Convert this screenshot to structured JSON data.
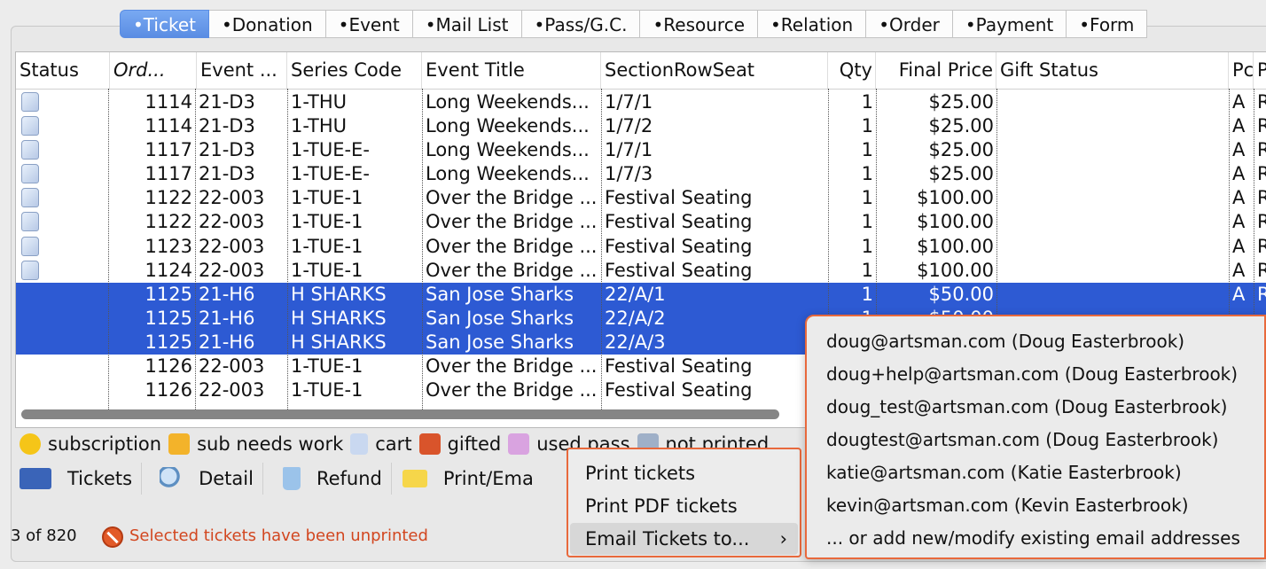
{
  "tabs": [
    "•Ticket",
    "•Donation",
    "•Event",
    "•Mail List",
    "•Pass/G.C.",
    "•Resource",
    "•Relation",
    "•Order",
    "•Payment",
    "•Form"
  ],
  "columns": [
    "Status",
    "Ord...",
    "Event ...",
    "Series Code",
    "Event Title",
    "SectionRowSeat",
    "Qty",
    "Final Price",
    "Gift Status",
    "Pc",
    "P"
  ],
  "rows": [
    {
      "order": "1114",
      "event": "21-D3",
      "series": "1-THU",
      "title": "Long Weekends...",
      "seat": "1/7/1",
      "qty": "1",
      "price": "$25.00",
      "pc": "A",
      "p": "R",
      "selected": false,
      "icon": true
    },
    {
      "order": "1114",
      "event": "21-D3",
      "series": "1-THU",
      "title": "Long Weekends...",
      "seat": "1/7/2",
      "qty": "1",
      "price": "$25.00",
      "pc": "A",
      "p": "R",
      "selected": false,
      "icon": true
    },
    {
      "order": "1117",
      "event": "21-D3",
      "series": "1-TUE-E-",
      "title": "Long Weekends...",
      "seat": "1/7/1",
      "qty": "1",
      "price": "$25.00",
      "pc": "A",
      "p": "R",
      "selected": false,
      "icon": true
    },
    {
      "order": "1117",
      "event": "21-D3",
      "series": "1-TUE-E-",
      "title": "Long Weekends...",
      "seat": "1/7/3",
      "qty": "1",
      "price": "$25.00",
      "pc": "A",
      "p": "R",
      "selected": false,
      "icon": true
    },
    {
      "order": "1122",
      "event": "22-003",
      "series": "1-TUE-1",
      "title": "Over the Bridge ...",
      "seat": "Festival Seating",
      "qty": "1",
      "price": "$100.00",
      "pc": "A",
      "p": "R",
      "selected": false,
      "icon": true
    },
    {
      "order": "1122",
      "event": "22-003",
      "series": "1-TUE-1",
      "title": "Over the Bridge ...",
      "seat": "Festival Seating",
      "qty": "1",
      "price": "$100.00",
      "pc": "A",
      "p": "R",
      "selected": false,
      "icon": true
    },
    {
      "order": "1123",
      "event": "22-003",
      "series": "1-TUE-1",
      "title": "Over the Bridge ...",
      "seat": "Festival Seating",
      "qty": "1",
      "price": "$100.00",
      "pc": "A",
      "p": "R",
      "selected": false,
      "icon": true
    },
    {
      "order": "1124",
      "event": "22-003",
      "series": "1-TUE-1",
      "title": "Over the Bridge ...",
      "seat": "Festival Seating",
      "qty": "1",
      "price": "$100.00",
      "pc": "A",
      "p": "R",
      "selected": false,
      "icon": true
    },
    {
      "order": "1125",
      "event": "21-H6",
      "series": "H SHARKS",
      "title": "San Jose Sharks",
      "seat": "22/A/1",
      "qty": "1",
      "price": "$50.00",
      "pc": "A",
      "p": "R",
      "selected": true,
      "icon": false
    },
    {
      "order": "1125",
      "event": "21-H6",
      "series": "H SHARKS",
      "title": "San Jose Sharks",
      "seat": "22/A/2",
      "qty": "1",
      "price": "$50.00",
      "pc": "",
      "p": "",
      "selected": true,
      "icon": false
    },
    {
      "order": "1125",
      "event": "21-H6",
      "series": "H SHARKS",
      "title": "San Jose Sharks",
      "seat": "22/A/3",
      "qty": "",
      "price": "",
      "pc": "",
      "p": "",
      "selected": true,
      "icon": false
    },
    {
      "order": "1126",
      "event": "22-003",
      "series": "1-TUE-1",
      "title": "Over the Bridge ...",
      "seat": "Festival Seating",
      "qty": "",
      "price": "",
      "pc": "",
      "p": "",
      "selected": false,
      "icon": false
    },
    {
      "order": "1126",
      "event": "22-003",
      "series": "1-TUE-1",
      "title": "Over the Bridge ...",
      "seat": "Festival Seating",
      "qty": "",
      "price": "",
      "pc": "",
      "p": "",
      "selected": false,
      "icon": false
    }
  ],
  "legend": [
    {
      "label": "subscription",
      "icon": "smiley-icon",
      "color": "#f5c518"
    },
    {
      "label": "sub needs work",
      "icon": "box-icon",
      "color": "#f3b32a"
    },
    {
      "label": "cart",
      "icon": "cart-ticket-icon",
      "color": "#c9d8f0"
    },
    {
      "label": "gifted",
      "icon": "gift-icon",
      "color": "#d9542b"
    },
    {
      "label": "used pass",
      "icon": "used-pass-icon",
      "color": "#d9a3e0"
    },
    {
      "label": "not printed",
      "icon": "not-printed-icon",
      "color": "#9fb0c8"
    }
  ],
  "buttons": [
    {
      "label": "Tickets",
      "icon": "tickets-icon"
    },
    {
      "label": "Detail",
      "icon": "magnifier-icon"
    },
    {
      "label": "Refund",
      "icon": "trash-icon"
    },
    {
      "label": "Print/Ema",
      "icon": "envelope-icon"
    }
  ],
  "status": {
    "count": "3 of 820",
    "message": "Selected tickets have been unprinted"
  },
  "menu": {
    "items": [
      "Print tickets",
      "Print PDF tickets",
      "Email Tickets to..."
    ],
    "submenu_arrow": "›"
  },
  "email_menu": [
    "doug@artsman.com (Doug Easterbrook)",
    "doug+help@artsman.com (Doug Easterbrook)",
    "doug_test@artsman.com (Doug Easterbrook)",
    "dougtest@artsman.com (Doug Easterbrook)",
    "katie@artsman.com (Katie Easterbrook)",
    "kevin@artsman.com (Kevin Easterbrook)",
    "... or add new/modify existing email addresses"
  ],
  "colors": {
    "selection": "#2d5ad3",
    "active_tab": "#5a8de3",
    "menu_border": "#e8693c",
    "status_message": "#d2461f"
  }
}
